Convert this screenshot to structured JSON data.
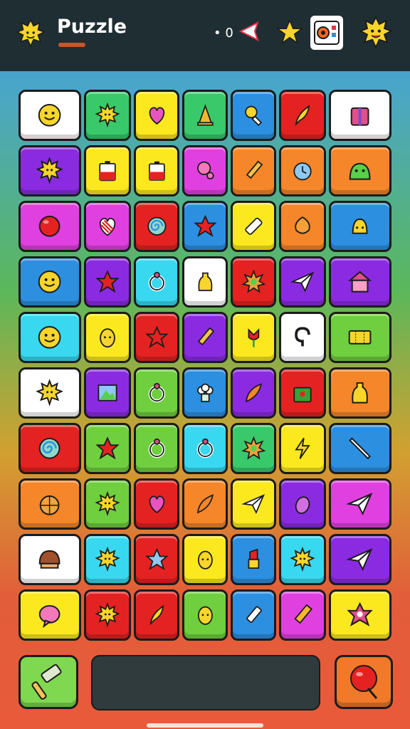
{
  "header": {
    "title": "Puzzle",
    "moves_text": "• 0"
  },
  "colors": {
    "header_bg": "#1f2e33",
    "title_accent": "#c8552a",
    "tile_yellow": "#fbe81f",
    "tile_green": "#6fcf3e",
    "tile_blue": "#2c8fe0",
    "tile_red": "#e42222",
    "tile_orange": "#f5862a",
    "tile_purple": "#8a2be2",
    "tile_magenta": "#e040e0",
    "tile_cyan": "#38d8f0",
    "tile_white": "#ffffff"
  },
  "board": {
    "rows": [
      [
        {
          "color": "#ffffff",
          "icon": "smiley-icon"
        },
        {
          "color": "#39c96a",
          "icon": "sun-icon"
        },
        {
          "color": "#fbe81f",
          "icon": "heart-icon"
        },
        {
          "color": "#39c96a",
          "icon": "cone-icon"
        },
        {
          "color": "#2c8fe0",
          "icon": "magnifier-icon"
        },
        {
          "color": "#e42222",
          "icon": "leaf-icon"
        },
        {
          "color": "#ffffff",
          "icon": "gift-icon"
        }
      ],
      [
        {
          "color": "#8a2be2",
          "icon": "sun-face-icon"
        },
        {
          "color": "#fbe81f",
          "icon": "battery-icon"
        },
        {
          "color": "#fbe81f",
          "icon": "battery-icon"
        },
        {
          "color": "#e040e0",
          "icon": "balloon-icon"
        },
        {
          "color": "#f5862a",
          "icon": "pencil-icon"
        },
        {
          "color": "#f5862a",
          "icon": "clock-icon"
        },
        {
          "color": "#f5862a",
          "icon": "slime-icon"
        }
      ],
      [
        {
          "color": "#e040e0",
          "icon": "ball-icon"
        },
        {
          "color": "#e040e0",
          "icon": "candy-heart-icon"
        },
        {
          "color": "#e42222",
          "icon": "swirl-icon"
        },
        {
          "color": "#2c8fe0",
          "icon": "star-icon"
        },
        {
          "color": "#fbe81f",
          "icon": "eraser-icon"
        },
        {
          "color": "#f5862a",
          "icon": "onion-icon"
        },
        {
          "color": "#2c8fe0",
          "icon": "bell-icon"
        }
      ],
      [
        {
          "color": "#2c8fe0",
          "icon": "smiley-icon"
        },
        {
          "color": "#8a2be2",
          "icon": "star-icon"
        },
        {
          "color": "#38d8f0",
          "icon": "ring-icon"
        },
        {
          "color": "#ffffff",
          "icon": "bottle-icon"
        },
        {
          "color": "#e42222",
          "icon": "burst-icon"
        },
        {
          "color": "#8a2be2",
          "icon": "paper-plane-icon"
        },
        {
          "color": "#8a2be2",
          "icon": "house-icon"
        }
      ],
      [
        {
          "color": "#38d8f0",
          "icon": "smiley-icon"
        },
        {
          "color": "#fbe81f",
          "icon": "lemon-icon"
        },
        {
          "color": "#e42222",
          "icon": "star-icon"
        },
        {
          "color": "#8a2be2",
          "icon": "pencil-icon"
        },
        {
          "color": "#fbe81f",
          "icon": "tulip-icon"
        },
        {
          "color": "#ffffff",
          "icon": "hook-icon"
        },
        {
          "color": "#6fcf3e",
          "icon": "ticket-icon"
        }
      ],
      [
        {
          "color": "#ffffff",
          "icon": "sun-icon"
        },
        {
          "color": "#8a2be2",
          "icon": "picture-icon"
        },
        {
          "color": "#6fcf3e",
          "icon": "ring-icon"
        },
        {
          "color": "#2c8fe0",
          "icon": "cauliflower-icon"
        },
        {
          "color": "#8a2be2",
          "icon": "feather-icon"
        },
        {
          "color": "#e42222",
          "icon": "bag-icon"
        },
        {
          "color": "#f5862a",
          "icon": "bottle-icon"
        }
      ],
      [
        {
          "color": "#e42222",
          "icon": "spiral-icon"
        },
        {
          "color": "#6fcf3e",
          "icon": "star-icon"
        },
        {
          "color": "#6fcf3e",
          "icon": "ring-icon"
        },
        {
          "color": "#38d8f0",
          "icon": "ring-icon"
        },
        {
          "color": "#39c96a",
          "icon": "burst-icon"
        },
        {
          "color": "#fbe81f",
          "icon": "lightning-icon"
        },
        {
          "color": "#2c8fe0",
          "icon": "wand-icon"
        }
      ],
      [
        {
          "color": "#f5862a",
          "icon": "basket-icon"
        },
        {
          "color": "#6fcf3e",
          "icon": "sun-face-icon"
        },
        {
          "color": "#e42222",
          "icon": "heart-icon"
        },
        {
          "color": "#f5862a",
          "icon": "feather-icon"
        },
        {
          "color": "#fbe81f",
          "icon": "paper-plane-icon"
        },
        {
          "color": "#8a2be2",
          "icon": "eggplant-icon"
        },
        {
          "color": "#e040e0",
          "icon": "paper-plane-icon"
        }
      ],
      [
        {
          "color": "#ffffff",
          "icon": "chestnut-icon"
        },
        {
          "color": "#38d8f0",
          "icon": "sun-face-icon"
        },
        {
          "color": "#e42222",
          "icon": "star-outline-icon"
        },
        {
          "color": "#fbe81f",
          "icon": "lemon-icon"
        },
        {
          "color": "#2c8fe0",
          "icon": "lipstick-icon"
        },
        {
          "color": "#38d8f0",
          "icon": "sun-icon"
        },
        {
          "color": "#8a2be2",
          "icon": "paper-plane-icon"
        }
      ],
      [
        {
          "color": "#fbe81f",
          "icon": "bubble-icon"
        },
        {
          "color": "#e42222",
          "icon": "sun-face-icon"
        },
        {
          "color": "#e42222",
          "icon": "leaf-icon"
        },
        {
          "color": "#6fcf3e",
          "icon": "lemon-icon"
        },
        {
          "color": "#2c8fe0",
          "icon": "flashlight-icon"
        },
        {
          "color": "#e040e0",
          "icon": "crayon-icon"
        },
        {
          "color": "#fbe81f",
          "icon": "flower-icon"
        }
      ]
    ]
  },
  "footer": {
    "left_button_icon": "hammer-icon",
    "right_button_icon": "balloon-icon"
  }
}
